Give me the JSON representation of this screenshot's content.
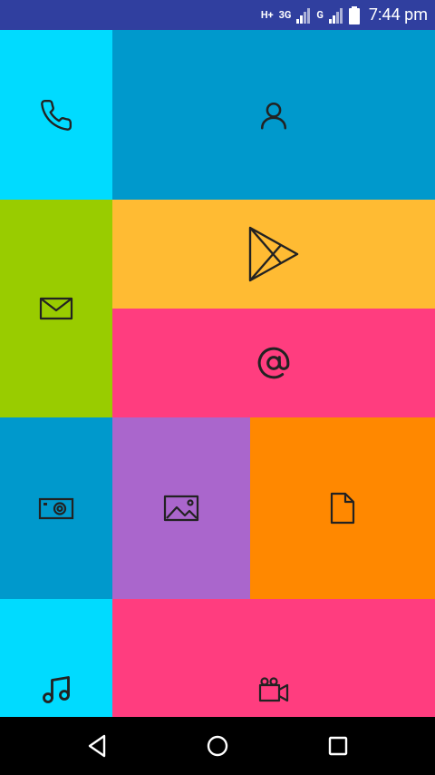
{
  "status_bar": {
    "network_label_1": "H+",
    "network_label_2": "3G",
    "network_label_3": "G",
    "time": "7:44 pm"
  },
  "tiles": [
    {
      "name": "phone",
      "icon": "phone-icon",
      "color": "#00dbff"
    },
    {
      "name": "contacts",
      "icon": "person-icon",
      "color": "#0099cc"
    },
    {
      "name": "mail",
      "icon": "envelope-icon",
      "color": "#99cc00"
    },
    {
      "name": "play-store",
      "icon": "play-store-icon",
      "color": "#ffbb33"
    },
    {
      "name": "email-at",
      "icon": "at-sign-icon",
      "color": "#ff3d7f"
    },
    {
      "name": "camera",
      "icon": "camera-icon",
      "color": "#0099cc"
    },
    {
      "name": "gallery",
      "icon": "image-icon",
      "color": "#aa66cc"
    },
    {
      "name": "files",
      "icon": "document-icon",
      "color": "#ff8800"
    },
    {
      "name": "music",
      "icon": "music-note-icon",
      "color": "#00dbff"
    },
    {
      "name": "video",
      "icon": "video-camera-icon",
      "color": "#ff3d7f"
    }
  ],
  "nav_bar": {
    "back": "back-triangle-icon",
    "home": "home-circle-icon",
    "recents": "recents-square-icon"
  }
}
